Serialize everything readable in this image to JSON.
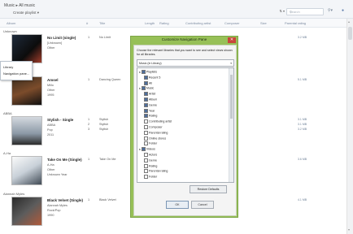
{
  "header": {
    "breadcrumb": "Music ▸ All music",
    "create_playlist": "Create playlist ▾",
    "view_toggle": "⇅ ▾",
    "search_placeholder": "Search",
    "search_icon": "search-icon",
    "help_icon": "help-icon"
  },
  "columns": [
    "Album",
    "#",
    "Title",
    "Length",
    "Rating",
    "Contributing artist",
    "Composer",
    "Size",
    "Parental rating"
  ],
  "context_menu": {
    "items": [
      "Library",
      "Navigation pane..."
    ]
  },
  "albums": [
    {
      "group": "Unknown",
      "title": "No Limit (single)",
      "meta": [
        "[Unknown]",
        "Other",
        ""
      ],
      "num": "1",
      "track": "No Limit",
      "size": "3.2 MB",
      "art": "t1"
    },
    {
      "group": "",
      "title": "Amsel",
      "meta": [
        "Millo",
        "Other",
        "1995"
      ],
      "num": "1",
      "track": "Dancing Queen",
      "size": "5.1 MB",
      "art": "t2"
    },
    {
      "group": "ABBA",
      "title": "Stylish - Single",
      "meta": [
        "ABBA",
        "Pop",
        "2011"
      ],
      "num": "1",
      "track": "Stylish",
      "size": "3.1 MB",
      "art": "t3"
    },
    {
      "group": "A-Ha",
      "title": "Take On Me (Single)",
      "meta": [
        "A-Ha",
        "Other",
        "Unknown Year"
      ],
      "num": "1",
      "track": "Take On Me",
      "size": "3.6 MB",
      "art": "t4"
    },
    {
      "group": "Alannah Myles",
      "title": "Black Velvet (Single)",
      "meta": [
        "Alannah Myles",
        "Rock/Pop",
        "1990"
      ],
      "num": "1",
      "track": "Black Velvet",
      "size": "4.1 MB",
      "art": "t5"
    }
  ],
  "extra_rows": [
    "Stylish",
    "Stylish"
  ],
  "extra_sizes": [
    "3.1 MB",
    "3.2 MB"
  ],
  "dialog": {
    "title": "Customize Navigation Pane",
    "close": "✕",
    "description": "Choose the relevant libraries that you want to see and select views shown for all libraries.",
    "library_select": "Music (in Library)",
    "tree": [
      {
        "label": "Playlists",
        "level": 0,
        "checked": true,
        "expander": "▴"
      },
      {
        "label": "Recent 5",
        "level": 1,
        "checked": true
      },
      {
        "label": "All",
        "level": 1,
        "checked": true
      },
      {
        "label": "Music",
        "level": 0,
        "checked": true,
        "expander": "▴"
      },
      {
        "label": "Artist",
        "level": 1,
        "checked": true
      },
      {
        "label": "Album",
        "level": 1,
        "checked": true
      },
      {
        "label": "Genre",
        "level": 1,
        "checked": true
      },
      {
        "label": "Year",
        "level": 1,
        "checked": true
      },
      {
        "label": "Rating",
        "level": 1,
        "checked": true
      },
      {
        "label": "Contributing artist",
        "level": 1,
        "checked": false
      },
      {
        "label": "Composer",
        "level": 1,
        "checked": false
      },
      {
        "label": "Parental rating",
        "level": 1,
        "checked": false
      },
      {
        "label": "Online stores",
        "level": 1,
        "checked": false
      },
      {
        "label": "Folder",
        "level": 1,
        "checked": false
      },
      {
        "label": "Videos",
        "level": 0,
        "checked": true,
        "expander": "▴"
      },
      {
        "label": "Actors",
        "level": 1,
        "checked": false
      },
      {
        "label": "Genre",
        "level": 1,
        "checked": false
      },
      {
        "label": "Rating",
        "level": 1,
        "checked": false
      },
      {
        "label": "Parental rating",
        "level": 1,
        "checked": false
      },
      {
        "label": "Folder",
        "level": 1,
        "checked": false
      }
    ],
    "restore_defaults": "Restore Defaults",
    "ok": "OK",
    "cancel": "Cancel"
  },
  "colors": {
    "dialog_frame": "#97c057",
    "close_button": "#c9463b",
    "accent": "#4f6f9c"
  }
}
